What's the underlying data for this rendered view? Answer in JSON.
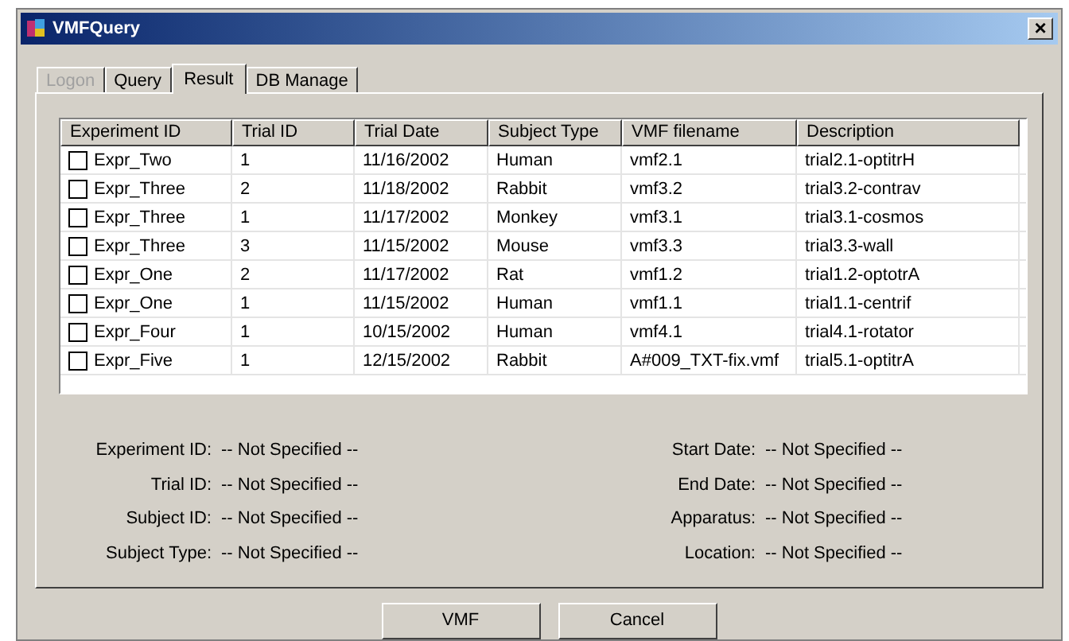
{
  "window": {
    "title": "VMFQuery",
    "close": "×"
  },
  "tabs": [
    {
      "label": "Logon",
      "selected": false,
      "disabled": true
    },
    {
      "label": "Query",
      "selected": false,
      "disabled": false
    },
    {
      "label": "Result",
      "selected": true,
      "disabled": false
    },
    {
      "label": "DB Manage",
      "selected": false,
      "disabled": false
    }
  ],
  "table": {
    "columns": [
      "Experiment ID",
      "Trial ID",
      "Trial Date",
      "Subject Type",
      "VMF filename",
      "Description"
    ],
    "rows": [
      {
        "checked": false,
        "cells": [
          "Expr_Two",
          "1",
          "11/16/2002",
          "Human",
          "vmf2.1",
          "trial2.1-optitrH"
        ]
      },
      {
        "checked": false,
        "cells": [
          "Expr_Three",
          "2",
          "11/18/2002",
          "Rabbit",
          "vmf3.2",
          "trial3.2-contrav"
        ]
      },
      {
        "checked": false,
        "cells": [
          "Expr_Three",
          "1",
          "11/17/2002",
          "Monkey",
          "vmf3.1",
          "trial3.1-cosmos"
        ]
      },
      {
        "checked": false,
        "cells": [
          "Expr_Three",
          "3",
          "11/15/2002",
          "Mouse",
          "vmf3.3",
          "trial3.3-wall"
        ]
      },
      {
        "checked": false,
        "cells": [
          "Expr_One",
          "2",
          "11/17/2002",
          "Rat",
          "vmf1.2",
          "trial1.2-optotrA"
        ]
      },
      {
        "checked": false,
        "cells": [
          "Expr_One",
          "1",
          "11/15/2002",
          "Human",
          "vmf1.1",
          "trial1.1-centrif"
        ]
      },
      {
        "checked": false,
        "cells": [
          "Expr_Four",
          "1",
          "10/15/2002",
          "Human",
          "vmf4.1",
          "trial4.1-rotator"
        ]
      },
      {
        "checked": false,
        "cells": [
          "Expr_Five",
          "1",
          "12/15/2002",
          "Rabbit",
          "A#009_TXT-fix.vmf",
          "trial5.1-optitrA"
        ]
      }
    ]
  },
  "details": {
    "left": [
      {
        "label": "Experiment ID:",
        "value": "-- Not Specified --"
      },
      {
        "label": "Trial ID:",
        "value": "-- Not Specified --"
      },
      {
        "label": "Subject ID:",
        "value": "-- Not Specified --"
      },
      {
        "label": "Subject Type:",
        "value": "-- Not Specified --"
      }
    ],
    "right": [
      {
        "label": "Start Date:",
        "value": "-- Not Specified --"
      },
      {
        "label": "End Date:",
        "value": "-- Not Specified --"
      },
      {
        "label": "Apparatus:",
        "value": "-- Not Specified --"
      },
      {
        "label": "Location:",
        "value": "-- Not Specified --"
      }
    ]
  },
  "buttons": [
    "VMF",
    "Cancel"
  ]
}
